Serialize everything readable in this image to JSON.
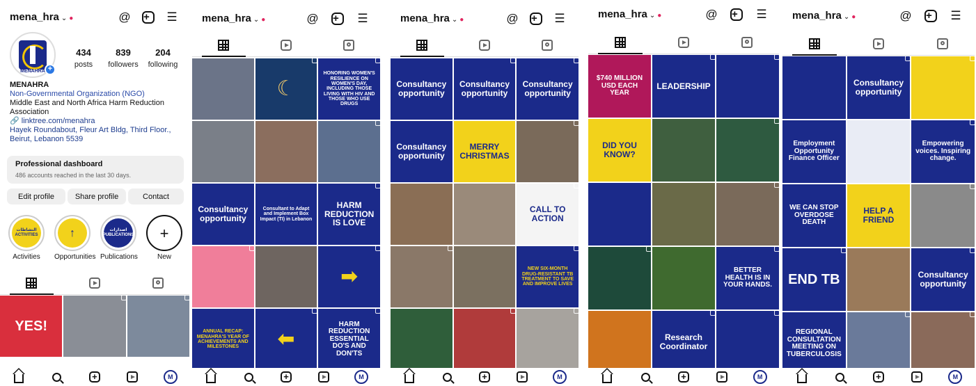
{
  "username": "mena_hra",
  "profile": {
    "avatar_text": "MENAHRA",
    "stats": [
      {
        "value": "434",
        "label": "posts"
      },
      {
        "value": "839",
        "label": "followers"
      },
      {
        "value": "204",
        "label": "following"
      }
    ],
    "name": "MENAHRA",
    "category": "Non-Governmental Organization (NGO)",
    "bio_line": "Middle East and North Africa Harm Reduction Association",
    "link": "linktree.com/menahra",
    "address": "Hayek Roundabout, Fleur Art Bldg, Third Floor., Beirut, Lebanon 5539",
    "dashboard_title": "Professional dashboard",
    "dashboard_sub": "486 accounts reached in the last 30 days.",
    "buttons": [
      "Edit profile",
      "Share profile",
      "Contact"
    ],
    "highlights": [
      {
        "label": "Activities",
        "inner": "النشاطات\nACTIVITIES",
        "color": "#f2d21b"
      },
      {
        "label": "Opportunities",
        "inner": "↑",
        "color": "#f2d21b"
      },
      {
        "label": "Publications",
        "inner": "اصدارات\nPUBLICATIONS",
        "color": "#1b2a8a"
      },
      {
        "label": "New",
        "inner": "+",
        "color": "#ffffff"
      }
    ]
  },
  "icons": {
    "top": [
      "chevron-down-icon",
      "threads-icon",
      "add-icon",
      "menu-icon"
    ],
    "tabs": [
      "grid-icon",
      "reels-icon",
      "tagged-icon"
    ],
    "nav": [
      "home-icon",
      "search-icon",
      "create-icon",
      "reels-icon",
      "profile-avatar-icon"
    ]
  },
  "colors": {
    "navy": "#1b2a8a",
    "yellow": "#f2d21b",
    "link": "#2a4aa8"
  },
  "screens": [
    {
      "posts": [
        {
          "text": "YES!",
          "bg": "#d92f3d",
          "fg": "#ffffff"
        },
        {
          "text": "",
          "bg": "#8a8e96",
          "fg": "#ffffff"
        },
        {
          "text": "",
          "bg": "#7d8a9c",
          "fg": "#ffffff"
        }
      ]
    },
    {
      "posts": [
        {
          "text": "",
          "bg": "#6b7488",
          "fg": "#ffffff"
        },
        {
          "text": "☾",
          "bg": "#183a6a",
          "fg": "#e8c36a"
        },
        {
          "text": "HONORING WOMEN'S RESILIENCE ON WOMEN'S DAY, INCLUDING THOSE LIVING WITH HIV AND THOSE WHO USE DRUGS",
          "bg": "#1b2a8a",
          "fg": "#ffffff"
        },
        {
          "text": "",
          "bg": "#7a7f88",
          "fg": "#ffffff"
        },
        {
          "text": "",
          "bg": "#8b6e5e",
          "fg": "#ffffff"
        },
        {
          "text": "",
          "bg": "#5c6f8f",
          "fg": "#ffffff"
        },
        {
          "text": "Consultancy opportunity",
          "bg": "#1b2a8a",
          "fg": "#ffffff"
        },
        {
          "text": "Consultant to Adapt and Implement Box Impact (TI) in Lebanon",
          "bg": "#1b2a8a",
          "fg": "#ffffff"
        },
        {
          "text": "HARM REDUCTION IS LOVE",
          "bg": "#1b2a8a",
          "fg": "#ffffff"
        },
        {
          "text": "",
          "bg": "#f07e9a",
          "fg": "#ffffff"
        },
        {
          "text": "",
          "bg": "#6e6560",
          "fg": "#ffffff"
        },
        {
          "text": "➡",
          "bg": "#1b2a8a",
          "fg": "#f2d21b"
        },
        {
          "text": "ANNUAL RECAP: MENAHRA'S YEAR OF ACHIEVEMENTS AND MILESTONES",
          "bg": "#1b2a8a",
          "fg": "#f2d21b"
        },
        {
          "text": "⬅",
          "bg": "#1b2a8a",
          "fg": "#f2d21b"
        },
        {
          "text": "HARM REDUCTION ESSENTIAL DO'S AND DON'TS",
          "bg": "#1b2a8a",
          "fg": "#ffffff"
        }
      ]
    },
    {
      "posts": [
        {
          "text": "Consultancy opportunity",
          "bg": "#1b2a8a",
          "fg": "#ffffff"
        },
        {
          "text": "Consultancy opportunity",
          "bg": "#1b2a8a",
          "fg": "#ffffff"
        },
        {
          "text": "Consultancy opportunity",
          "bg": "#1b2a8a",
          "fg": "#ffffff"
        },
        {
          "text": "Consultancy opportunity",
          "bg": "#1b2a8a",
          "fg": "#ffffff"
        },
        {
          "text": "MERRY CHRISTMAS",
          "bg": "#f2d21b",
          "fg": "#1b2a8a"
        },
        {
          "text": "",
          "bg": "#7a6a5a",
          "fg": "#ffffff"
        },
        {
          "text": "",
          "bg": "#8a6e55",
          "fg": "#ffffff"
        },
        {
          "text": "",
          "bg": "#9a8a7a",
          "fg": "#ffffff"
        },
        {
          "text": "CALL TO ACTION",
          "bg": "#f4f4f4",
          "fg": "#1b2a8a"
        },
        {
          "text": "",
          "bg": "#8a7868",
          "fg": "#ffffff"
        },
        {
          "text": "",
          "bg": "#7b7060",
          "fg": "#ffffff"
        },
        {
          "text": "NEW SIX-MONTH DRUG-RESISTANT TB TREATMENT TO SAVE AND IMPROVE LIVES",
          "bg": "#1b2a8a",
          "fg": "#f2d21b"
        },
        {
          "text": "",
          "bg": "#2f5e3a",
          "fg": "#ffffff"
        },
        {
          "text": "",
          "bg": "#b03b3b",
          "fg": "#ffffff"
        },
        {
          "text": "",
          "bg": "#a7a39e",
          "fg": "#ffffff"
        }
      ]
    },
    {
      "posts": [
        {
          "text": "$740 MILLION USD EACH YEAR",
          "bg": "#b0185a",
          "fg": "#ffffff"
        },
        {
          "text": "LEADERSHIP",
          "bg": "#1b2a8a",
          "fg": "#ffffff"
        },
        {
          "text": "",
          "bg": "#1b2a8a",
          "fg": "#ffffff"
        },
        {
          "text": "DID YOU KNOW?",
          "bg": "#f2d21b",
          "fg": "#1b2a8a"
        },
        {
          "text": "",
          "bg": "#3f5f3f",
          "fg": "#ffffff"
        },
        {
          "text": "",
          "bg": "#2e5a40",
          "fg": "#ffffff"
        },
        {
          "text": "",
          "bg": "#1b2a8a",
          "fg": "#ffffff"
        },
        {
          "text": "",
          "bg": "#6a6a48",
          "fg": "#ffffff"
        },
        {
          "text": "",
          "bg": "#7a6a5a",
          "fg": "#ffffff"
        },
        {
          "text": "",
          "bg": "#1e4a3a",
          "fg": "#ffffff"
        },
        {
          "text": "",
          "bg": "#3f6a2f",
          "fg": "#ffffff"
        },
        {
          "text": "BETTER HEALTH IS IN YOUR HANDS.",
          "bg": "#1b2a8a",
          "fg": "#ffffff"
        },
        {
          "text": "",
          "bg": "#d0741e",
          "fg": "#ffffff"
        },
        {
          "text": "Research Coordinator",
          "bg": "#1b2a8a",
          "fg": "#ffffff"
        },
        {
          "text": "",
          "bg": "#1b2a8a",
          "fg": "#ffffff"
        }
      ]
    },
    {
      "posts": [
        {
          "text": "",
          "bg": "#1b2a8a",
          "fg": "#ffffff"
        },
        {
          "text": "Consultancy opportunity",
          "bg": "#1b2a8a",
          "fg": "#ffffff"
        },
        {
          "text": "",
          "bg": "#f2d21b",
          "fg": "#1b2a8a"
        },
        {
          "text": "Employment Opportunity Finance Officer",
          "bg": "#1b2a8a",
          "fg": "#ffffff"
        },
        {
          "text": "",
          "bg": "#e9ecf5",
          "fg": "#1b2a8a"
        },
        {
          "text": "Empowering voices. Inspiring change.",
          "bg": "#1b2a8a",
          "fg": "#ffffff"
        },
        {
          "text": "WE CAN STOP OVERDOSE DEATH",
          "bg": "#1b2a8a",
          "fg": "#ffffff"
        },
        {
          "text": "HELP A FRIEND",
          "bg": "#f2d21b",
          "fg": "#1b2a8a"
        },
        {
          "text": "",
          "bg": "#8a8a8a",
          "fg": "#ffffff"
        },
        {
          "text": "END TB",
          "bg": "#1b2a8a",
          "fg": "#ffffff"
        },
        {
          "text": "",
          "bg": "#9a7a5a",
          "fg": "#ffffff"
        },
        {
          "text": "Consultancy opportunity",
          "bg": "#1b2a8a",
          "fg": "#ffffff"
        },
        {
          "text": "REGIONAL CONSULTATION MEETING ON TUBERCULOSIS",
          "bg": "#1b2a8a",
          "fg": "#ffffff"
        },
        {
          "text": "",
          "bg": "#6a7a9a",
          "fg": "#ffffff"
        },
        {
          "text": "",
          "bg": "#8a6a5a",
          "fg": "#ffffff"
        }
      ]
    }
  ]
}
